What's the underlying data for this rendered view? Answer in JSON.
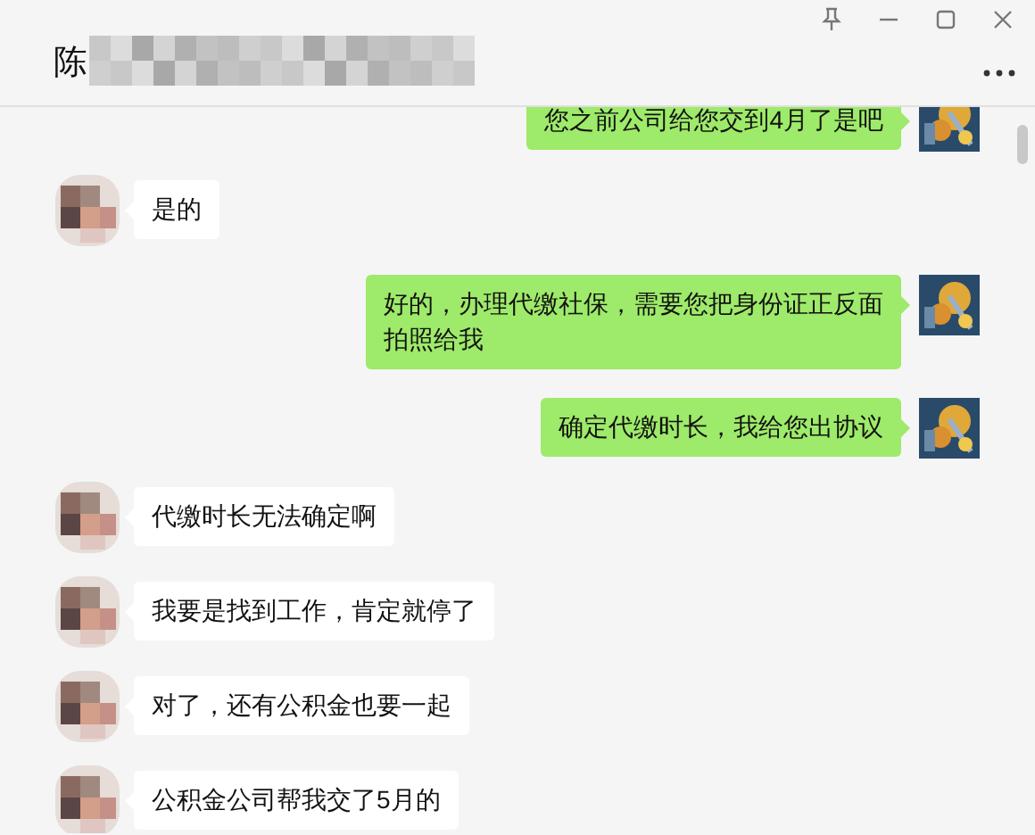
{
  "window": {
    "title": "陈"
  },
  "messages": [
    {
      "kind": "outgoing",
      "text": "您之前公司给您交到4月了是吧"
    },
    {
      "kind": "incoming",
      "text": "是的"
    },
    {
      "kind": "outgoing",
      "text": "好的，办理代缴社保，需要您把身份证正反面拍照给我"
    },
    {
      "kind": "outgoing",
      "text": "确定代缴时长，我给您出协议"
    },
    {
      "kind": "incoming",
      "text": "代缴时长无法确定啊"
    },
    {
      "kind": "incoming",
      "text": "我要是找到工作，肯定就停了"
    },
    {
      "kind": "incoming",
      "text": "对了，还有公积金也要一起"
    },
    {
      "kind": "incoming",
      "text": "公积金公司帮我交了5月的"
    }
  ]
}
